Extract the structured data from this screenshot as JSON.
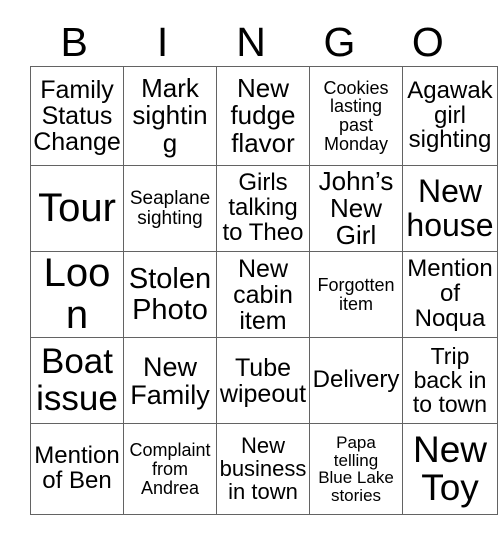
{
  "card": {
    "type": "bingo-card",
    "header_letters": [
      "B",
      "I",
      "N",
      "G",
      "O"
    ],
    "grid_size": "5x5",
    "colors": {
      "text": "#000000",
      "grid_line": "#636363",
      "background": "#ffffff"
    },
    "rows": [
      [
        {
          "text": "Family\nStatus\nChange",
          "lines": 3
        },
        {
          "text": "Mark\nsighting",
          "lines": 2
        },
        {
          "text": "New\nfudge\nflavor",
          "lines": 3
        },
        {
          "text": "Cookies\nlasting\npast\nMonday",
          "lines": 4
        },
        {
          "text": "Agawak\ngirl\nsighting",
          "lines": 3
        }
      ],
      [
        {
          "text": "Tour",
          "lines": 1
        },
        {
          "text": "Seaplane\nsighting",
          "lines": 2
        },
        {
          "text": "Girls\ntalking\nto Theo",
          "lines": 3
        },
        {
          "text": "John’s\nNew\nGirl",
          "lines": 3
        },
        {
          "text": "New\nhouse",
          "lines": 2
        }
      ],
      [
        {
          "text": "Loon",
          "lines": 1
        },
        {
          "text": "Stolen\nPhoto",
          "lines": 2
        },
        {
          "text": "New\ncabin\nitem",
          "lines": 3
        },
        {
          "text": "Forgotten\nitem",
          "lines": 2
        },
        {
          "text": "Mention\nof\nNoqua",
          "lines": 3
        }
      ],
      [
        {
          "text": "Boat\nissue",
          "lines": 2
        },
        {
          "text": "New\nFamily",
          "lines": 2
        },
        {
          "text": "Tube\nwipeout",
          "lines": 2
        },
        {
          "text": "Delivery",
          "lines": 1
        },
        {
          "text": "Trip\nback in\nto town",
          "lines": 3
        }
      ],
      [
        {
          "text": "Mention\nof Ben",
          "lines": 2
        },
        {
          "text": "Complaint\nfrom\nAndrea",
          "lines": 3
        },
        {
          "text": "New\nbusiness\nin town",
          "lines": 3
        },
        {
          "text": "Papa\ntelling\nBlue Lake\nstories",
          "lines": 4
        },
        {
          "text": "New\nToy",
          "lines": 2
        }
      ]
    ],
    "font_sizes": [
      [
        25,
        26,
        26,
        18,
        24
      ],
      [
        40,
        19,
        24,
        26,
        32
      ],
      [
        40,
        29,
        25,
        18,
        24
      ],
      [
        35,
        27,
        25,
        24,
        23
      ],
      [
        24,
        18,
        22,
        17,
        37
      ]
    ]
  }
}
